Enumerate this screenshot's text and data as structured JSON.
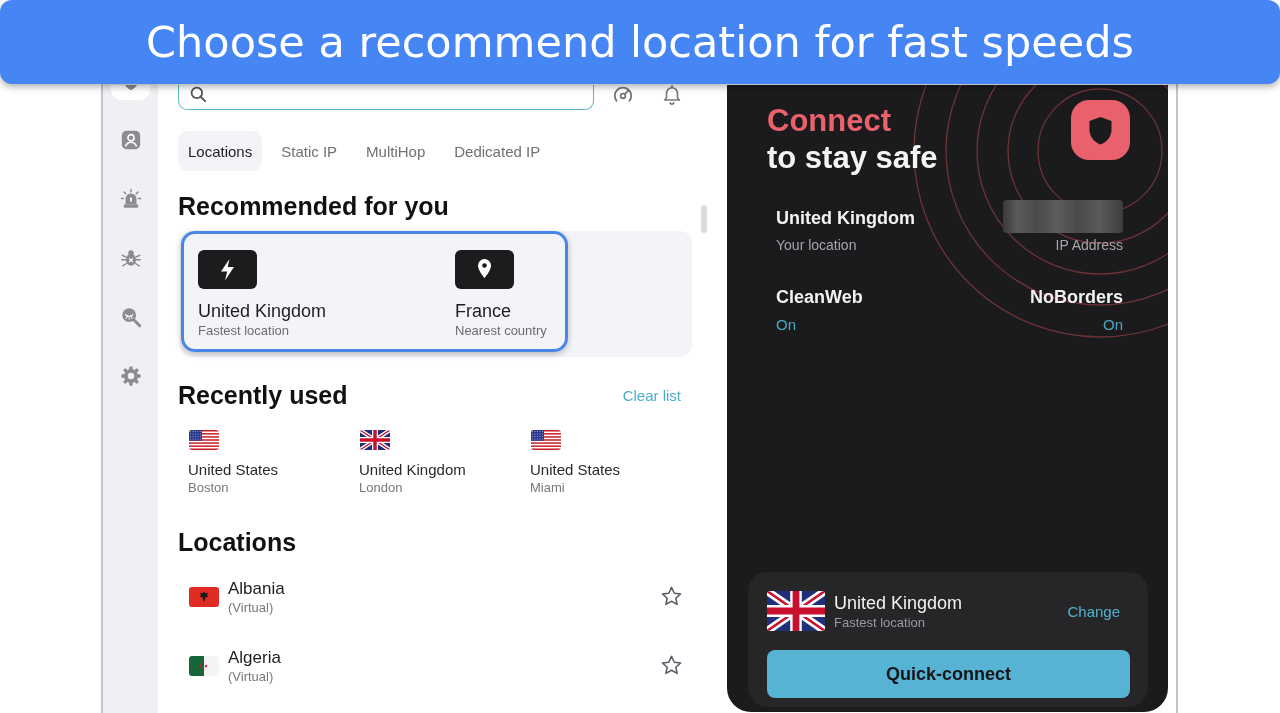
{
  "caption": "Choose a recommend location for fast speeds",
  "sidebar": {
    "items": [
      {
        "selected": true
      },
      {
        "selected": false
      },
      {
        "selected": false
      },
      {
        "selected": false
      },
      {
        "selected": false
      },
      {
        "selected": false
      }
    ]
  },
  "tabs": [
    {
      "label": "Locations",
      "selected": true
    },
    {
      "label": "Static IP",
      "selected": false
    },
    {
      "label": "MultiHop",
      "selected": false
    },
    {
      "label": "Dedicated IP",
      "selected": false
    }
  ],
  "recommended": {
    "title": "Recommended for you",
    "highlighted": true,
    "items": [
      {
        "kind": "fastest",
        "name": "United Kingdom",
        "note": "Fastest location"
      },
      {
        "kind": "nearest",
        "name": "France",
        "note": "Nearest country"
      }
    ]
  },
  "recent": {
    "title": "Recently used",
    "clear_link": "Clear list",
    "items": [
      {
        "kind": "us",
        "country": "United States",
        "city": "Boston"
      },
      {
        "kind": "gb",
        "country": "United Kingdom",
        "city": "London"
      },
      {
        "kind": "us",
        "country": "United States",
        "city": "Miami"
      }
    ]
  },
  "locations": {
    "title": "Locations",
    "items": [
      {
        "kind": "al",
        "name": "Albania",
        "note": "(Virtual)",
        "favorite": false
      },
      {
        "kind": "dz",
        "name": "Algeria",
        "note": "(Virtual)",
        "favorite": false
      }
    ]
  },
  "connect_panel": {
    "title_accent": "Connect",
    "title": "to stay safe",
    "info": [
      {
        "kind": "text",
        "value": "United Kingdom",
        "label": "Your location"
      },
      {
        "kind": "blurred",
        "label": "IP Address"
      }
    ],
    "features": [
      {
        "name": "CleanWeb",
        "status": "On"
      },
      {
        "name": "NoBorders",
        "status": "On"
      }
    ],
    "current": {
      "kind": "gb",
      "name": "United Kingdom",
      "note": "Fastest location",
      "action": "Change"
    },
    "button": "Quick-connect"
  }
}
